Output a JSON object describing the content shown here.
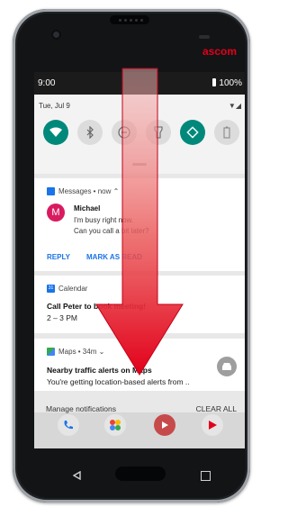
{
  "device": {
    "brand": "ascom"
  },
  "status_bar": {
    "time": "9:00",
    "battery": "100%"
  },
  "quick_settings": {
    "date": "Tue, Jul 9",
    "tiles": [
      {
        "icon": "wifi-icon",
        "active": true
      },
      {
        "icon": "bluetooth-icon",
        "active": false
      },
      {
        "icon": "do-not-disturb-icon",
        "active": false
      },
      {
        "icon": "flashlight-icon",
        "active": false
      },
      {
        "icon": "auto-rotate-icon",
        "active": true
      },
      {
        "icon": "battery-saver-icon",
        "active": false
      }
    ]
  },
  "notifications": {
    "messages": {
      "app_line": "Messages • now ⌃",
      "avatar_letter": "M",
      "sender": "Michael",
      "lines": [
        "I'm busy right now.",
        "Can you call a bit later?"
      ],
      "actions": [
        "REPLY",
        "MARK AS READ"
      ]
    },
    "calendar": {
      "app_line": "Calendar",
      "icon_text": "31",
      "title": "Call Peter to book meeting!",
      "time": "2 – 3 PM"
    },
    "maps": {
      "app_line": "Maps • 34m ⌄",
      "title": "Nearby traffic alerts on Maps",
      "text": "You're getting location-based alerts from .."
    }
  },
  "footer": {
    "manage": "Manage notifications",
    "clear_all": "CLEAR ALL"
  },
  "colors": {
    "accent": "#00897b",
    "link": "#1a73e8",
    "arrow": "#e2001a",
    "brand": "#e2001a"
  }
}
